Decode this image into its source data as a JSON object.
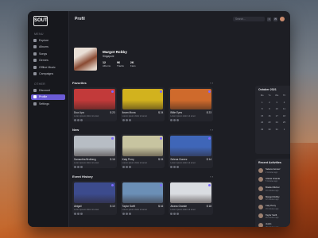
{
  "app": {
    "logo": "SOUT",
    "page_title": "Profil"
  },
  "sidebar": {
    "menu_label": "MENU",
    "items": [
      "Explore",
      "Albums",
      "Songs",
      "Genres",
      "Offline Music",
      "Campaigns"
    ],
    "other_label": "OTHER",
    "other_items": [
      "Discount",
      "Profile",
      "Settings"
    ],
    "active": "Profile"
  },
  "search": {
    "placeholder": "Search..."
  },
  "profile": {
    "name": "Margot Robby",
    "subtitle": "Singapore",
    "stats": [
      {
        "label": "Albums",
        "value": "12"
      },
      {
        "label": "Tracks",
        "value": "96"
      },
      {
        "label": "Fans",
        "value": "2K"
      }
    ]
  },
  "sections": [
    {
      "title": "Favorites",
      "cards": [
        {
          "name": "Dua Lipa",
          "price": "$ 23",
          "desc": "Lorem ipsum dolor sit amet",
          "color": "#c23a3a"
        },
        {
          "name": "Ikram Mona",
          "price": "$ 24",
          "desc": "Lorem ipsum dolor sit amet",
          "color": "#d2b21e"
        },
        {
          "name": "Billie Eyes",
          "price": "$ 23",
          "desc": "Lorem ipsum dolor sit amet",
          "color": "#cf6a2c"
        }
      ]
    },
    {
      "title": "New",
      "cards": [
        {
          "name": "Samantha Brolberg",
          "price": "$ 16",
          "desc": "Lorem ipsum dolor sit amet",
          "color": "#b7bdc4"
        },
        {
          "name": "Katy Perry",
          "price": "$ 15",
          "desc": "Lorem ipsum dolor sit amet",
          "color": "#c7c4a0"
        },
        {
          "name": "Selena Gomez",
          "price": "$ 14",
          "desc": "Lorem ipsum dolor sit amet",
          "color": "#3f66b8"
        }
      ]
    },
    {
      "title": "Event History",
      "cards": [
        {
          "name": "Abigail",
          "price": "$ 10",
          "desc": "Lorem ipsum dolor sit amet",
          "color": "#3c4b8d"
        },
        {
          "name": "Taylor Swift",
          "price": "$ 16",
          "desc": "Lorem ipsum dolor sit amet",
          "color": "#6b8fb6"
        },
        {
          "name": "Ariana Grande",
          "price": "$ 18",
          "desc": "Lorem ipsum dolor sit amet",
          "color": "#d9dce1"
        }
      ]
    }
  ],
  "calendar": {
    "month": "October 2021",
    "weekdays": [
      "Mo",
      "Tu",
      "We",
      "Th",
      "Fr",
      "Sa",
      "Su"
    ],
    "days": [
      "1",
      "2",
      "3",
      "4",
      "5",
      "6",
      "7",
      "8",
      "9",
      "10",
      "11",
      "12",
      "13",
      "14",
      "15",
      "16",
      "17",
      "18",
      "19",
      "20",
      "21",
      "22",
      "23",
      "24",
      "25",
      "26",
      "27",
      "28",
      "29",
      "30",
      "31",
      "1",
      "2",
      "3",
      "4"
    ],
    "today": "13"
  },
  "recent": {
    "title": "Recent Activities",
    "items": [
      {
        "name": "Selena Gomez",
        "meta": "2 minutes ago"
      },
      {
        "name": "Ariana Grande",
        "meta": "5 minutes ago"
      },
      {
        "name": "Brielle Mitchel",
        "meta": "10 minutes ago"
      },
      {
        "name": "Margot Robby",
        "meta": "12 minutes ago"
      },
      {
        "name": "Katy Perry",
        "meta": "15 minutes ago"
      },
      {
        "name": "Taylor Swift",
        "meta": "20 minutes ago"
      },
      {
        "name": "Justin",
        "meta": "25 minutes ago"
      }
    ]
  }
}
